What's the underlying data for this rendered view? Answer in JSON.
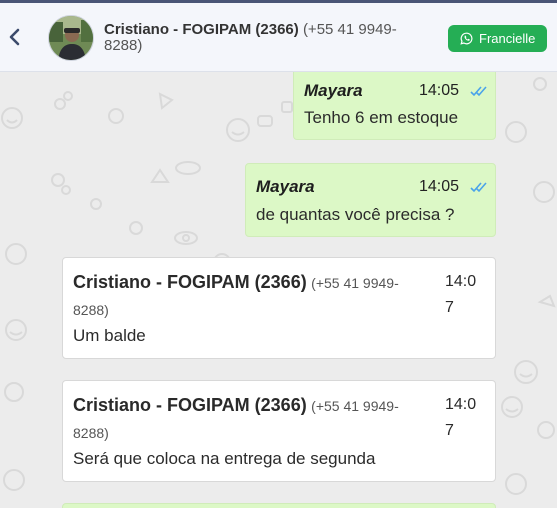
{
  "header": {
    "contact_name": "Cristiano - FOGIPAM (2366)",
    "contact_phone": "(+55 41 9949-8288)",
    "agent_button_label": "Francielle",
    "accent_color": "#25ae55"
  },
  "messages": [
    {
      "direction": "outgoing",
      "sender": "Mayara",
      "time": "14:05",
      "text": "Tenho 6 em estoque",
      "status": "read"
    },
    {
      "direction": "outgoing",
      "sender": "Mayara",
      "time": "14:05",
      "text": "de quantas você precisa ?",
      "status": "read"
    },
    {
      "direction": "incoming",
      "sender": "Cristiano - FOGIPAM (2366)",
      "phone": "(+55 41 9949-8288)",
      "time": "14:07",
      "text": "Um balde"
    },
    {
      "direction": "incoming",
      "sender": "Cristiano - FOGIPAM (2366)",
      "phone": "(+55 41 9949-8288)",
      "time": "14:07",
      "text": "Será que coloca na entrega de segunda"
    }
  ],
  "icons": {
    "back": "chevron-left-icon",
    "whatsapp": "whatsapp-icon",
    "read_status": "double-check-icon"
  }
}
